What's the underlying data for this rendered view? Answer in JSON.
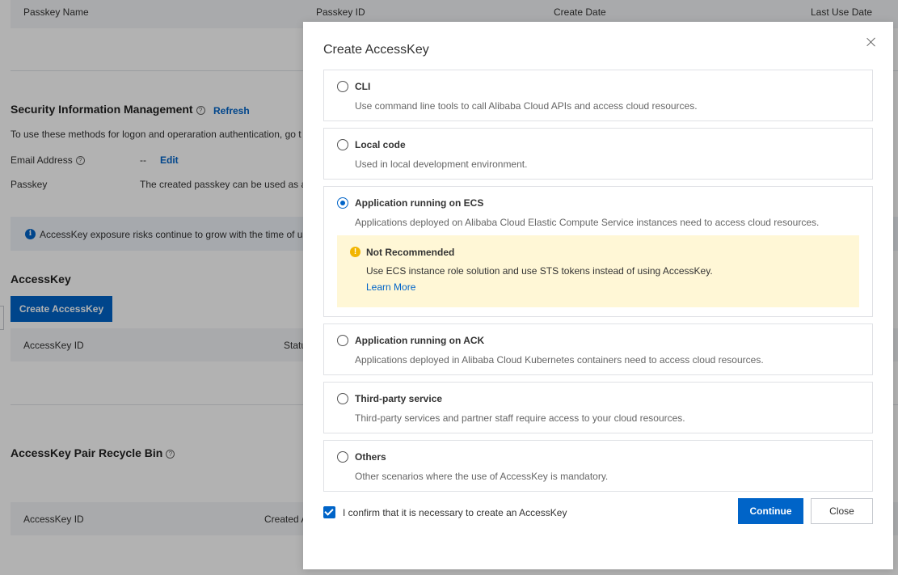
{
  "background": {
    "passkey_table": {
      "columns": [
        "Passkey Name",
        "Passkey ID",
        "Create Date",
        "Last Use Date"
      ]
    },
    "security_info": {
      "title": "Security Information Management",
      "refresh_label": "Refresh",
      "description": "To use these methods for logon and operaration authentication, go t",
      "email_label": "Email Address",
      "email_value": "--",
      "email_edit": "Edit",
      "passkey_label": "Passkey",
      "passkey_value": "The created passkey can be used as a"
    },
    "info_bar": {
      "text": "AccessKey exposure risks continue to grow with the time of us"
    },
    "accesskey": {
      "title": "AccessKey",
      "create_button": "Create AccessKey",
      "columns": [
        "AccessKey ID",
        "Statu"
      ]
    },
    "recycle_bin": {
      "title": "AccessKey Pair Recycle Bin",
      "columns": [
        "AccessKey ID",
        "Created A"
      ]
    }
  },
  "modal": {
    "title": "Create AccessKey",
    "options": [
      {
        "label": "CLI",
        "description": "Use command line tools to call Alibaba Cloud APIs and access cloud resources.",
        "checked": false
      },
      {
        "label": "Local code",
        "description": "Used in local development environment.",
        "checked": false
      },
      {
        "label": "Application running on ECS",
        "description": "Applications deployed on Alibaba Cloud Elastic Compute Service instances need to access cloud resources.",
        "checked": true
      },
      {
        "label": "Application running on ACK",
        "description": "Applications deployed in Alibaba Cloud Kubernetes containers need to access cloud resources.",
        "checked": false
      },
      {
        "label": "Third-party service",
        "description": "Third-party services and partner staff require access to your cloud resources.",
        "checked": false
      },
      {
        "label": "Others",
        "description": "Other scenarios where the use of AccessKey is mandatory.",
        "checked": false
      }
    ],
    "warning": {
      "title": "Not Recommended",
      "text": "Use ECS instance role solution and use STS tokens instead of using AccessKey.",
      "link": "Learn More"
    },
    "confirm_label": "I confirm that it is necessary to create an AccessKey",
    "confirm_checked": true,
    "continue_label": "Continue",
    "close_label": "Close"
  },
  "colors": {
    "primary": "#0064c8",
    "warning_bg": "#fff7d6",
    "warning_icon": "#f2b500",
    "overlay": "rgba(0,0,0,0.3)"
  }
}
